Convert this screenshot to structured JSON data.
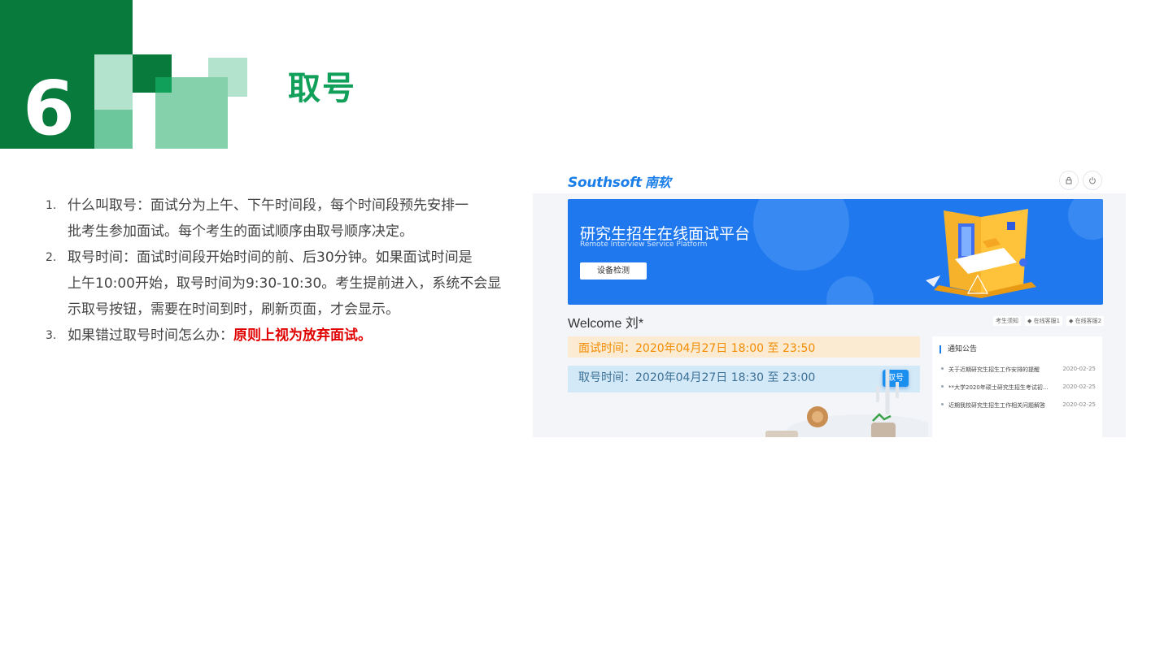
{
  "section": {
    "number": "6",
    "title": "取号"
  },
  "colors": {
    "green_dark": "#077a3c",
    "green_mid": "#11a05a",
    "green_light": "#6cc89c",
    "green_pale": "#b3e3cc",
    "accent_red": "#e00000",
    "blue": "#1f78ee"
  },
  "list": [
    {
      "num": "1.",
      "lines": [
        "什么叫取号：面试分为上午、下午时间段，每个时间段预先安排一",
        "批考生参加面试。每个考生的面试顺序由取号顺序决定。"
      ]
    },
    {
      "num": "2.",
      "lines": [
        "取号时间：面试时间段开始时间的前、后30分钟。如果面试时间是",
        "上午10:00开始，取号时间为9:30-10:30。考生提前进入，系统不会显",
        "示取号按钮，需要在时间到时，刷新页面，才会显示。"
      ]
    },
    {
      "num": "3.",
      "prefix": "如果错过取号时间怎么办：",
      "emphasis": "原则上视为放弃面试。"
    }
  ],
  "screenshot": {
    "logo": "Southsoft",
    "logo_cn": "南软",
    "top_icons": [
      "lock-icon",
      "power-icon"
    ],
    "banner_title": "研究生招生在线面试平台",
    "banner_subtitle": "Remote Interview Service Platform",
    "device_check": "设备检测",
    "welcome": "Welcome 刘*",
    "links": [
      "考生须知",
      "在线客服1",
      "在线客服2"
    ],
    "interview_time": "面试时间：2020年04月27日 18:00 至 23:50",
    "number_time": "取号时间：2020年04月27日 18:30 至 23:00",
    "take_number": "取号",
    "notice_title": "通知公告",
    "notices": [
      {
        "text": "关于近期研究生招生工作安排的提醒",
        "date": "2020-02-25"
      },
      {
        "text": "**大学2020年硕士研究生招生考试初...",
        "date": "2020-02-25"
      },
      {
        "text": "近期我校研究生招生工作相关问题解答",
        "date": "2020-02-25"
      }
    ]
  }
}
